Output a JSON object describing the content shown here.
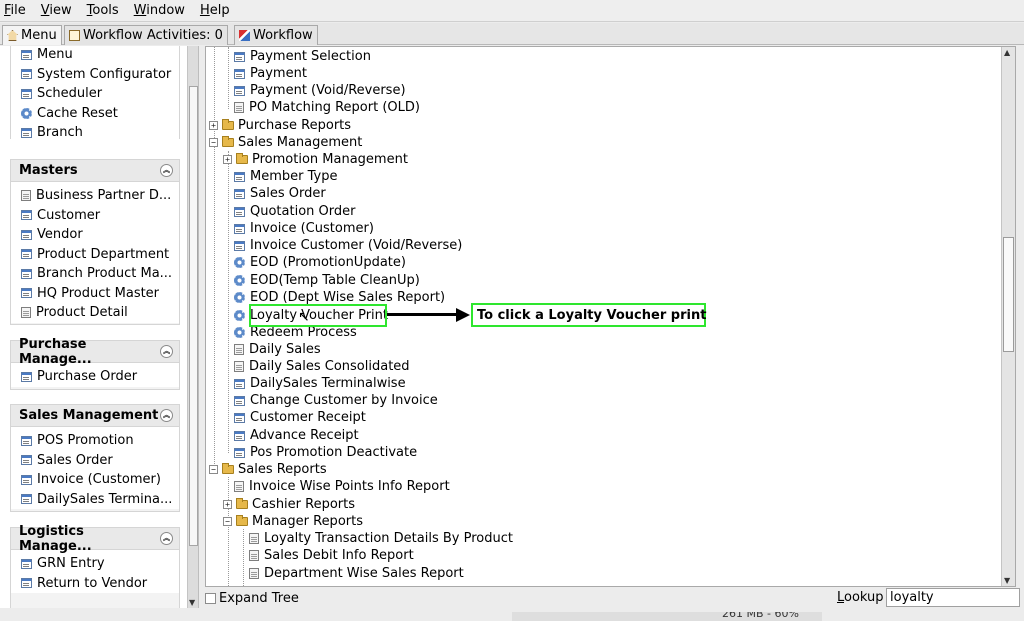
{
  "menubar": {
    "items": [
      {
        "label": "File",
        "key": "F"
      },
      {
        "label": "View",
        "key": "V"
      },
      {
        "label": "Tools",
        "key": "T"
      },
      {
        "label": "Window",
        "key": "W"
      },
      {
        "label": "Help",
        "key": "H"
      }
    ]
  },
  "tabs": {
    "menu": "Menu",
    "workflow_activities": "Workflow Activities: 0",
    "workflow": "Workflow"
  },
  "left_panel": {
    "top_items": [
      "Menu",
      "System Configurator",
      "Scheduler",
      "Cache Reset",
      "Branch"
    ],
    "sections": [
      {
        "title": "Masters",
        "items": [
          "Business Partner D...",
          "Customer",
          "Vendor",
          "Product Department",
          "Branch Product Ma...",
          "HQ Product Master",
          "Product Detail"
        ]
      },
      {
        "title": "Purchase Manage...",
        "items": [
          "Purchase Order"
        ]
      },
      {
        "title": "Sales Management",
        "items": [
          "POS Promotion",
          "Sales Order",
          "Invoice (Customer)",
          "DailySales Termina..."
        ]
      },
      {
        "title": "Logistics Manage...",
        "items": [
          "GRN Entry",
          "Return to Vendor"
        ]
      }
    ]
  },
  "tree": {
    "rows": [
      "Payment Selection",
      "Payment",
      "Payment (Void/Reverse)",
      "PO Matching Report (OLD)",
      "Purchase Reports",
      "Sales Management",
      "Promotion Management",
      "Member Type",
      "Sales Order",
      "Quotation Order",
      "Invoice (Customer)",
      "Invoice Customer (Void/Reverse)",
      "EOD (PromotionUpdate)",
      "EOD(Temp Table CleanUp)",
      "EOD (Dept Wise Sales Report)",
      "Loyalty Voucher Print",
      "Redeem Process",
      "Daily Sales",
      "Daily Sales Consolidated",
      "DailySales Terminalwise",
      "Change Customer by Invoice",
      "Customer Receipt",
      "Advance Receipt",
      "Pos Promotion Deactivate",
      "Sales Reports",
      "Invoice Wise Points Info Report",
      "Cashier Reports",
      "Manager Reports",
      "Loyalty Transaction Details By Product",
      "Sales Debit Info Report",
      "Department Wise Sales Report"
    ],
    "annotation": "To click a Loyalty Voucher print"
  },
  "bottom": {
    "expand_tree": "Expand Tree",
    "lookup_label": "Lookup",
    "lookup_value": "loyalty"
  },
  "status": {
    "text": "261 MB - 60%"
  },
  "colors": {
    "highlight": "#2ee62e",
    "folder": "#e6b84a",
    "gear": "#5c8ac9"
  }
}
